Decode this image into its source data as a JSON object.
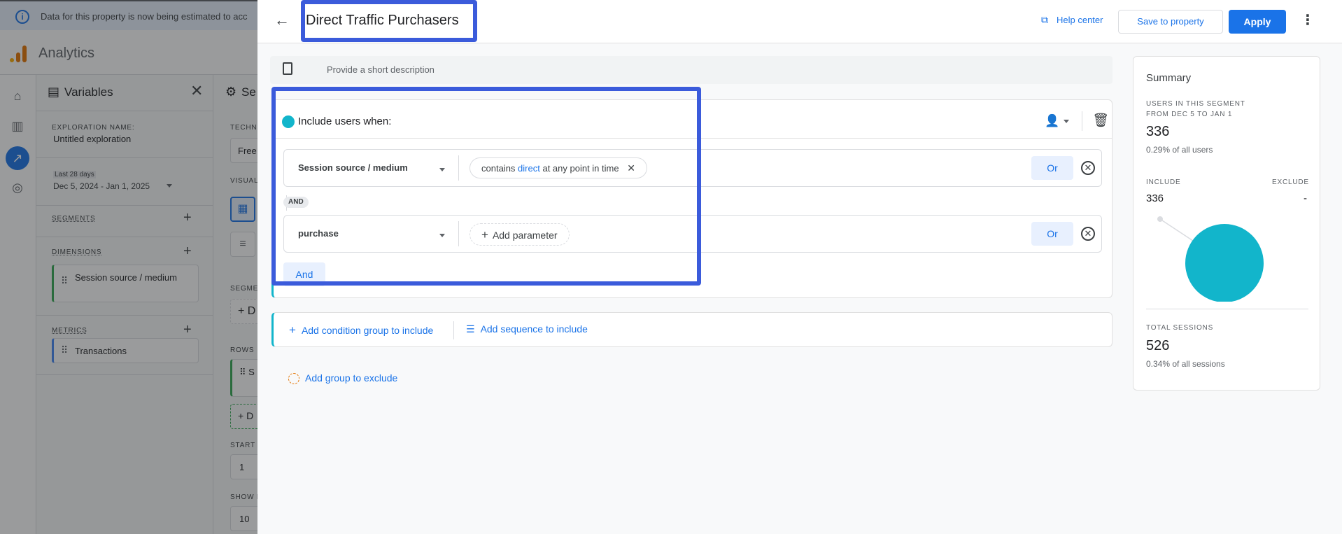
{
  "banner": {
    "text": "Data for this property is now being estimated to acc"
  },
  "app": {
    "name": "Analytics"
  },
  "variables": {
    "title": "Variables",
    "exploration_name_label": "EXPLORATION NAME:",
    "exploration_name": "Untitled exploration",
    "date_range_label": "Last 28 days",
    "date_range": "Dec 5, 2024 - Jan 1, 2025",
    "segments_label": "SEGMENTS",
    "dimensions_label": "DIMENSIONS",
    "dimension_item": "Session source / medium",
    "metrics_label": "METRICS",
    "metric_item": "Transactions"
  },
  "settings": {
    "title": "Se",
    "technique_label": "TECHNI",
    "technique_value": "Free",
    "visual_label": "VISUAL",
    "segments_label": "SEGME",
    "rows_label": "ROWS",
    "row_item": "S",
    "start_label": "START",
    "start_value": "1",
    "show_label": "SHOW R",
    "show_value": "10"
  },
  "modal": {
    "title": "Direct Traffic Purchasers",
    "help_center": "Help center",
    "save_to_property": "Save to property",
    "apply": "Apply",
    "description_placeholder": "Provide a short description",
    "include_header": "Include users when:",
    "condition1": {
      "field": "Session source / medium",
      "chip_pre": "contains",
      "chip_value": "direct",
      "chip_post": "at any point in time",
      "or_label": "Or"
    },
    "and_badge": "AND",
    "condition2": {
      "field": "purchase",
      "add_param": "Add parameter",
      "or_label": "Or"
    },
    "and_button": "And",
    "add_condition_group": "Add condition group to include",
    "add_sequence": "Add sequence to include",
    "add_group_exclude": "Add group to exclude"
  },
  "summary": {
    "title": "Summary",
    "users_label_line1": "USERS IN THIS SEGMENT",
    "users_label_line2": "FROM DEC 5 TO JAN 1",
    "users_value": "336",
    "users_pct": "0.29% of all users",
    "include_label": "INCLUDE",
    "exclude_label": "EXCLUDE",
    "include_value": "336",
    "exclude_value": "-",
    "total_sessions_label": "TOTAL SESSIONS",
    "total_sessions_value": "526",
    "total_sessions_pct": "0.34% of all sessions",
    "pie_include_fraction": 1.0,
    "pie_color": "#12b5cb"
  }
}
